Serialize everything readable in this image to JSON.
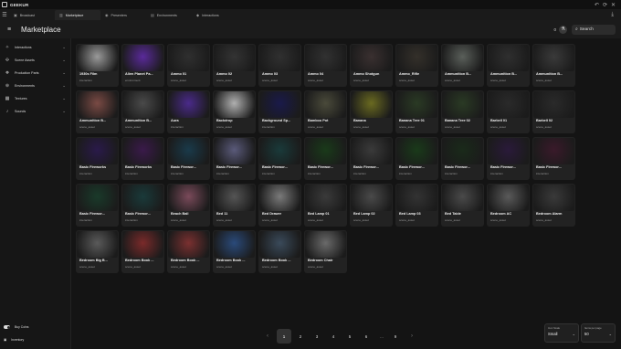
{
  "app": {
    "name": "GEEKUR",
    "window_controls": [
      "↶",
      "⟳",
      "✕"
    ]
  },
  "tabs": [
    {
      "label": "Broadcast",
      "icon": "▣",
      "active": false
    },
    {
      "label": "Marketplace",
      "icon": "▥",
      "active": true
    },
    {
      "label": "Presenters",
      "icon": "◉",
      "active": false
    },
    {
      "label": "Environments",
      "icon": "▤",
      "active": false
    },
    {
      "label": "Interactions",
      "icon": "◆",
      "active": false
    }
  ],
  "header": {
    "title": "Marketplace",
    "count": "0",
    "search_label": "Search"
  },
  "sidebar": {
    "items": [
      {
        "label": "Interactions",
        "icon": "✧"
      },
      {
        "label": "Scene Assets",
        "icon": "✣"
      },
      {
        "label": "Production Parts",
        "icon": "❖"
      },
      {
        "label": "Environments",
        "icon": "⊕"
      },
      {
        "label": "Textures",
        "icon": "▦"
      },
      {
        "label": "Sounds",
        "icon": "♪"
      }
    ],
    "bottom": [
      {
        "label": "Buy Coins"
      },
      {
        "label": "Inventory"
      }
    ]
  },
  "assets": [
    {
      "name": "1930s Film",
      "category": "interaction",
      "thumb": "#9a9a9a"
    },
    {
      "name": "Alien Planet Pa...",
      "category": "environment",
      "thumb": "#5a2a9a"
    },
    {
      "name": "Ammo 01",
      "category": "scene_asset",
      "thumb": "#2f2f2f"
    },
    {
      "name": "Ammo 02",
      "category": "scene_asset",
      "thumb": "#333333"
    },
    {
      "name": "Ammo 03",
      "category": "scene_asset",
      "thumb": "#303030"
    },
    {
      "name": "Ammo 04",
      "category": "scene_asset",
      "thumb": "#313131"
    },
    {
      "name": "Ammo Shotgun",
      "category": "scene_asset",
      "thumb": "#3a3030"
    },
    {
      "name": "Ammo_Rifle",
      "category": "scene_asset",
      "thumb": "#34302a"
    },
    {
      "name": "Ammunition B...",
      "category": "scene_asset",
      "thumb": "#5a5f5a"
    },
    {
      "name": "Ammunition B...",
      "category": "scene_asset",
      "thumb": "#2f2f2f"
    },
    {
      "name": "Ammunition B...",
      "category": "scene_asset",
      "thumb": "#3a3a3a"
    },
    {
      "name": "Ammunition B...",
      "category": "scene_asset",
      "thumb": "#7a4a44"
    },
    {
      "name": "Ammunition B...",
      "category": "scene_asset",
      "thumb": "#4a4a4a"
    },
    {
      "name": "Aura",
      "category": "interaction",
      "thumb": "#4a2a8a"
    },
    {
      "name": "Backdrop",
      "category": "scene_asset",
      "thumb": "#b0b0b0"
    },
    {
      "name": "Background Sp...",
      "category": "interaction",
      "thumb": "#1a1a4a"
    },
    {
      "name": "Bamboo Pot",
      "category": "scene_asset",
      "thumb": "#4a4a3a"
    },
    {
      "name": "Banana",
      "category": "scene_asset",
      "thumb": "#6a6a20"
    },
    {
      "name": "Banana Tree 01",
      "category": "scene_asset",
      "thumb": "#2a3a24"
    },
    {
      "name": "Banana Tree 02",
      "category": "scene_asset",
      "thumb": "#2a3a24"
    },
    {
      "name": "Barbell 01",
      "category": "scene_asset",
      "thumb": "#2a2a2a"
    },
    {
      "name": "Barbell 02",
      "category": "scene_asset",
      "thumb": "#2a2a2a"
    },
    {
      "name": "Basic Fireworks",
      "category": "interaction",
      "thumb": "#2a1a4a"
    },
    {
      "name": "Basic Fireworks",
      "category": "interaction",
      "thumb": "#3a1a4a"
    },
    {
      "name": "Basic Firewor...",
      "category": "interaction",
      "thumb": "#1a3a4a"
    },
    {
      "name": "Basic Firewor...",
      "category": "interaction",
      "thumb": "#5a5a7a"
    },
    {
      "name": "Basic Firewor...",
      "category": "interaction",
      "thumb": "#1a3a3a"
    },
    {
      "name": "Basic Firewor...",
      "category": "interaction",
      "thumb": "#1a3a1a"
    },
    {
      "name": "Basic Firewor...",
      "category": "interaction",
      "thumb": "#3a3a3a"
    },
    {
      "name": "Basic Firewor...",
      "category": "interaction",
      "thumb": "#1a3a1a"
    },
    {
      "name": "Basic Firewor...",
      "category": "interaction",
      "thumb": "#1a2a1a"
    },
    {
      "name": "Basic Firewor...",
      "category": "interaction",
      "thumb": "#2a1a3a"
    },
    {
      "name": "Basic Firewor...",
      "category": "interaction",
      "thumb": "#3a1a2a"
    },
    {
      "name": "Basic Firewor...",
      "category": "interaction",
      "thumb": "#1a3a2a"
    },
    {
      "name": "Basic Firewor...",
      "category": "interaction",
      "thumb": "#1a3a3a"
    },
    {
      "name": "Beach Ball",
      "category": "scene_asset",
      "thumb": "#7a4a5a"
    },
    {
      "name": "Bed 11",
      "category": "scene_asset",
      "thumb": "#555555"
    },
    {
      "name": "Bed Drawer",
      "category": "scene_asset",
      "thumb": "#7a7a7a"
    },
    {
      "name": "Bed Lamp 01",
      "category": "scene_asset",
      "thumb": "#3a3a3a"
    },
    {
      "name": "Bed Lamp 02",
      "category": "scene_asset",
      "thumb": "#4a4a4a"
    },
    {
      "name": "Bed Lamp 03",
      "category": "scene_asset",
      "thumb": "#333333"
    },
    {
      "name": "Bed Table",
      "category": "scene_asset",
      "thumb": "#4a4a4a"
    },
    {
      "name": "Bedroom AC",
      "category": "scene_asset",
      "thumb": "#5a5a5a"
    },
    {
      "name": "Bedroom Alarm",
      "category": "scene_asset",
      "thumb": "#3a3a3a"
    },
    {
      "name": "Bedroom Big B...",
      "category": "scene_asset",
      "thumb": "#5a5a5a"
    },
    {
      "name": "Bedroom Book ...",
      "category": "scene_asset",
      "thumb": "#7a2a2a"
    },
    {
      "name": "Bedroom Book ...",
      "category": "scene_asset",
      "thumb": "#7a3030"
    },
    {
      "name": "Bedroom Book ...",
      "category": "scene_asset",
      "thumb": "#2a4a7a"
    },
    {
      "name": "Bedroom Book ...",
      "category": "scene_asset",
      "thumb": "#3a4a5a"
    },
    {
      "name": "Bedroom Chair",
      "category": "scene_asset",
      "thumb": "#6a6a6a"
    }
  ],
  "pagination": {
    "prev": "‹",
    "pages": [
      "1",
      "2",
      "3",
      "4",
      "5",
      "6"
    ],
    "dots": "...",
    "last": "9",
    "next": "›",
    "current": "1"
  },
  "controls": {
    "icon_size": {
      "label": "Icon Scale",
      "value": "Small"
    },
    "per_page": {
      "label": "Items per page",
      "value": "50"
    }
  }
}
